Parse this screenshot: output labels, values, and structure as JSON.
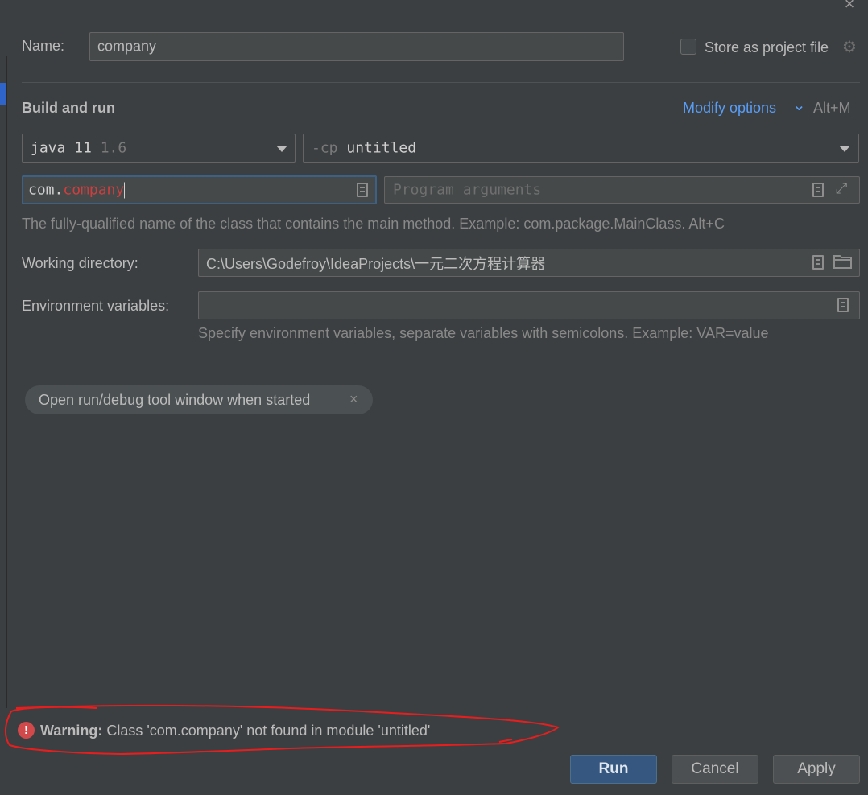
{
  "window": {
    "close_glyph": "×"
  },
  "name_row": {
    "label": "Name:",
    "value": "company"
  },
  "store_project_file": {
    "label": "Store as project file",
    "checked": false,
    "icon": "gear-icon"
  },
  "section": {
    "title": "Build and run"
  },
  "modify_options": {
    "label": "Modify options",
    "chevron": "⌄",
    "shortcut": "Alt+M"
  },
  "jre_combo": {
    "value": "java 11",
    "version": "1.6"
  },
  "classpath_combo": {
    "prefix": "-cp",
    "value": "untitled"
  },
  "main_class": {
    "prefix": "com.",
    "value_error": "company",
    "error_color": "#cc3f3f"
  },
  "program_args": {
    "placeholder": "Program arguments"
  },
  "main_class_hint": "The fully-qualified name of the class that contains the main method. Example: com.package.MainClass. Alt+C",
  "working_dir": {
    "label": "Working directory:",
    "value": "C:\\Users\\Godefroy\\IdeaProjects\\一元二次方程计算器"
  },
  "env_vars": {
    "label": "Environment variables:",
    "value": "",
    "hint": "Specify environment variables, separate variables with semicolons. Example: VAR=value"
  },
  "option_chip": {
    "label": "Open run/debug tool window when started",
    "remove_glyph": "×"
  },
  "warning": {
    "icon_glyph": "!",
    "title": "Warning:",
    "message": "Class 'com.company' not found in module 'untitled'"
  },
  "buttons": {
    "run": "Run",
    "cancel": "Cancel",
    "apply": "Apply"
  },
  "colors": {
    "background": "#3c3f41",
    "accent": "#589df6",
    "primary_button": "#365880",
    "error": "#d2494b",
    "annotation": "#ff0000"
  }
}
